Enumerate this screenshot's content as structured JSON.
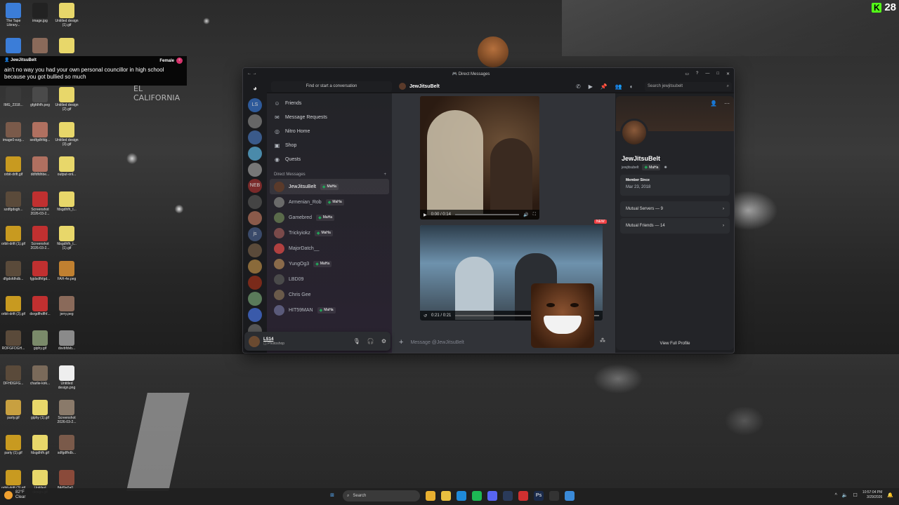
{
  "overlay": {
    "kick_count": "28",
    "chat": {
      "username": "JewJitsuBelt",
      "gender": "Female",
      "message": "ain't no way you had your own personal councillor in high school because you got bullied so much"
    },
    "street_sign": "EL CALIFORNIA"
  },
  "desktop_icons": [
    {
      "label": "The Tape Library...",
      "color": "#3b7dd8"
    },
    {
      "label": "image.jpg",
      "color": "#222"
    },
    {
      "label": "Untitled design (1).gif",
      "color": "#e8d76a"
    },
    {
      "label": "",
      "color": "#3b7dd8"
    },
    {
      "label": "",
      "color": "#8a6a5a"
    },
    {
      "label": "",
      "color": "#e8d76a"
    },
    {
      "label": "IMG_2318...",
      "color": "#3a3a3a"
    },
    {
      "label": "gfgfdhfh.peg",
      "color": "#4a4a4a"
    },
    {
      "label": "Untitled design (2).gif",
      "color": "#e8d76a"
    },
    {
      "label": "image0-ezg...",
      "color": "#7a5a4a"
    },
    {
      "label": "sedfgdhfdg...",
      "color": "#b07060"
    },
    {
      "label": "Untitled design (3).gif",
      "color": "#e8d76a"
    },
    {
      "label": "orbit-drift.gif",
      "color": "#c89a20"
    },
    {
      "label": "ddfdfdhbe...",
      "color": "#b07060"
    },
    {
      "label": "output-onl...",
      "color": "#e8d76a"
    },
    {
      "label": "szdfgdsgh...",
      "color": "#5a4a3a"
    },
    {
      "label": "Screenshot 2026-03-2...",
      "color": "#c03030"
    },
    {
      "label": "fdsgdhfh_t...",
      "color": "#e8d76a"
    },
    {
      "label": "orbit-drift (1).gif",
      "color": "#c89a20"
    },
    {
      "label": "Screenshot 2026-03-2...",
      "color": "#c03030"
    },
    {
      "label": "fdsgdhfh_t... (1).gif",
      "color": "#e8d76a"
    },
    {
      "label": "dfgdsfdhdb...",
      "color": "#5a4a3a"
    },
    {
      "label": "fgjdsdfhfgd...",
      "color": "#c03030"
    },
    {
      "label": "FAH-4e.peg",
      "color": "#c08030"
    },
    {
      "label": "orbit-drift (2).gif",
      "color": "#c89a20"
    },
    {
      "label": "dsrgdfhdfhf...",
      "color": "#c03030"
    },
    {
      "label": "jerry.peg",
      "color": "#8a6a5a"
    },
    {
      "label": "ROFGFDGH...",
      "color": "#5a4a3a"
    },
    {
      "label": "giphy.gif",
      "color": "#7a8a6a"
    },
    {
      "label": "dsvbfdvb...",
      "color": "#8a8a8a"
    },
    {
      "label": "DFHDGFG...",
      "color": "#5a4a3a"
    },
    {
      "label": "charlie-kirk...",
      "color": "#7a6a5a"
    },
    {
      "label": "Untitled design.png",
      "color": "#eeeeee"
    },
    {
      "label": "party.gif",
      "color": "#c8a040"
    },
    {
      "label": "giphy (1).gif",
      "color": "#e8d76a"
    },
    {
      "label": "Screenshot 2026-03-2...",
      "color": "#8a7a6a"
    },
    {
      "label": "party (1).gif",
      "color": "#c89a20"
    },
    {
      "label": "fdsgdhfh.gif",
      "color": "#e8d76a"
    },
    {
      "label": "sdfgdfhdb...",
      "color": "#7a5a4a"
    },
    {
      "label": "orbit-drift (3).gif",
      "color": "#c89a20"
    },
    {
      "label": "Untitled design.gif",
      "color": "#e8d76a"
    },
    {
      "label": "84d9a0a0...",
      "color": "#8a4a3a"
    }
  ],
  "discord": {
    "window_title": "Direct Messages",
    "search_placeholder": "Find or start a conversation",
    "servers": [
      "LS",
      "",
      "",
      "",
      "",
      "NEB",
      "",
      "",
      "js",
      "",
      "",
      "",
      "",
      "",
      ""
    ],
    "nav": [
      {
        "icon": "friends-icon",
        "glyph": "☺",
        "label": "Friends"
      },
      {
        "icon": "message-requests-icon",
        "glyph": "✉",
        "label": "Message Requests"
      },
      {
        "icon": "nitro-icon",
        "glyph": "◎",
        "label": "Nitro Home"
      },
      {
        "icon": "shop-icon",
        "glyph": "▣",
        "label": "Shop"
      },
      {
        "icon": "quests-icon",
        "glyph": "◉",
        "label": "Quests"
      }
    ],
    "dm_header": "Direct Messages",
    "dm_add": "+",
    "dms": [
      {
        "name": "JewJitsuBelt",
        "tag": "MaHa",
        "active": true,
        "color": "#5a3a2a"
      },
      {
        "name": "Armenian_Rob",
        "tag": "MaHa",
        "active": false,
        "color": "#6a6a6a"
      },
      {
        "name": "Gamebred",
        "tag": "MaHa",
        "active": false,
        "color": "#5a6a4a"
      },
      {
        "name": "Trickyiokz",
        "tag": "MaHa",
        "active": false,
        "color": "#7a4a4a"
      },
      {
        "name": "MajorDatch__",
        "tag": "",
        "active": false,
        "color": "#b04040"
      },
      {
        "name": "YungOg3",
        "tag": "MaHa",
        "active": false,
        "color": "#8a6a4a"
      },
      {
        "name": "LBD09",
        "tag": "",
        "active": false,
        "color": "#4a4a4a"
      },
      {
        "name": "Chris Gee",
        "tag": "",
        "active": false,
        "color": "#6a5a4a"
      },
      {
        "name": "HIT59MAN",
        "tag": "MaHa",
        "active": false,
        "color": "#5a5a7a"
      }
    ],
    "user_panel": {
      "name": "LS14",
      "status": "Photoshop"
    },
    "chat": {
      "recipient": "JewJitsuBelt",
      "header_search": "Search jewjitsubelt",
      "video1_time": "0:00 / 0:14",
      "video2_time": "0:21 / 0:21",
      "new_label": "NEW",
      "message_placeholder": "Message @JewJitsuBelt"
    },
    "profile": {
      "display_name": "JewJitsuBelt",
      "username": "jewjitsubelt",
      "tag": "MaHa",
      "member_since_label": "Member Since",
      "member_since": "Mar 23, 2018",
      "mutual_servers": "Mutual Servers — 9",
      "mutual_friends": "Mutual Friends — 14",
      "view_full": "View Full Profile"
    }
  },
  "taskbar": {
    "temperature": "82°F",
    "weather": "Clear",
    "search": "Search",
    "time": "10:57:04 PM",
    "date": "3/29/2026",
    "apps": [
      "chrome",
      "files",
      "edge",
      "spotify",
      "discord",
      "steam",
      "adobe",
      "Ps",
      "terminal",
      "paint"
    ]
  },
  "colors": {
    "discord_bg": "#313338",
    "accent_green": "#23a559",
    "kick_green": "#53fc18"
  }
}
